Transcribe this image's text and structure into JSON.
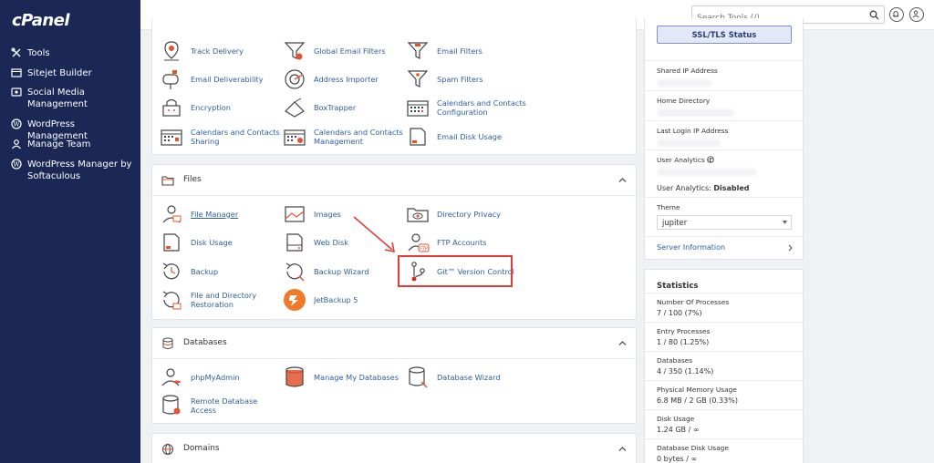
{
  "sidebar": {
    "logo": "cPanel",
    "items": [
      {
        "label": "Tools",
        "icon": "tools-icon"
      },
      {
        "label": "Sitejet Builder",
        "icon": "sitejet-icon"
      },
      {
        "label": "Social Media Management",
        "icon": "social-media-icon"
      },
      {
        "label": "WordPress Management",
        "icon": "wordpress-icon"
      },
      {
        "label": "Manage Team",
        "icon": "team-icon"
      },
      {
        "label": "WordPress Manager by Softaculous",
        "icon": "wordpress-icon"
      }
    ]
  },
  "topbar": {
    "search_placeholder": "Search Tools (/)"
  },
  "email_section": {
    "items": [
      {
        "label": "Track Delivery",
        "icon": "track-delivery-icon"
      },
      {
        "label": "Global Email Filters",
        "icon": "filter-icon"
      },
      {
        "label": "Email Filters",
        "icon": "filter-icon"
      },
      {
        "label": "Email Deliverability",
        "icon": "mailbox-icon"
      },
      {
        "label": "Address Importer",
        "icon": "address-importer-icon"
      },
      {
        "label": "Spam Filters",
        "icon": "spam-filter-icon"
      },
      {
        "label": "Encryption",
        "icon": "encryption-icon"
      },
      {
        "label": "BoxTrapper",
        "icon": "boxtrapper-icon"
      },
      {
        "label": "Calendars and Contacts Configuration",
        "icon": "calendar-icon"
      },
      {
        "label": "Calendars and Contacts Sharing",
        "icon": "calendar-icon"
      },
      {
        "label": "Calendars and Contacts Management",
        "icon": "calendar-icon"
      },
      {
        "label": "Email Disk Usage",
        "icon": "disk-usage-icon"
      }
    ]
  },
  "files_section": {
    "title": "Files",
    "items": [
      {
        "label": "File Manager",
        "icon": "file-manager-icon"
      },
      {
        "label": "Images",
        "icon": "images-icon"
      },
      {
        "label": "Directory Privacy",
        "icon": "directory-privacy-icon"
      },
      {
        "label": "Disk Usage",
        "icon": "disk-usage-icon"
      },
      {
        "label": "Web Disk",
        "icon": "web-disk-icon"
      },
      {
        "label": "FTP Accounts",
        "icon": "ftp-icon"
      },
      {
        "label": "Backup",
        "icon": "backup-icon"
      },
      {
        "label": "Backup Wizard",
        "icon": "backup-wizard-icon"
      },
      {
        "label": "Git™ Version Control",
        "icon": "git-icon"
      },
      {
        "label": "File and Directory Restoration",
        "icon": "restore-icon"
      },
      {
        "label": "JetBackup 5",
        "icon": "jetbackup-icon"
      }
    ]
  },
  "databases_section": {
    "title": "Databases",
    "items": [
      {
        "label": "phpMyAdmin",
        "icon": "phpmyadmin-icon"
      },
      {
        "label": "Manage My Databases",
        "icon": "database-icon"
      },
      {
        "label": "Database Wizard",
        "icon": "database-wizard-icon"
      },
      {
        "label": "Remote Database Access",
        "icon": "remote-db-icon"
      }
    ]
  },
  "domains_section": {
    "title": "Domains"
  },
  "general_info": {
    "ssl_button": "SSL/TLS Status",
    "shared_ip_label": "Shared IP Address",
    "home_dir_label": "Home Directory",
    "last_login_label": "Last Login IP Address",
    "analytics_id_label": "User Analytics ID",
    "analytics_status_label": "User Analytics:",
    "analytics_status_value": "Disabled",
    "theme_label": "Theme",
    "theme_value": "jupiter",
    "server_info_label": "Server Information"
  },
  "statistics": {
    "title": "Statistics",
    "rows": [
      {
        "label": "Number Of Processes",
        "value": "7 / 100  (7%)"
      },
      {
        "label": "Entry Processes",
        "value": "1 / 80  (1.25%)"
      },
      {
        "label": "Databases",
        "value": "4 / 350  (1.14%)"
      },
      {
        "label": "Physical Memory Usage",
        "value": "6.8 MB / 2 GB  (0.33%)"
      },
      {
        "label": "Disk Usage",
        "value": "1.24 GB / ∞"
      },
      {
        "label": "Database Disk Usage",
        "value": "0 bytes / ∞"
      }
    ]
  },
  "colors": {
    "sidebar_bg": "#1b2855",
    "link": "#2c5f9e",
    "highlight": "#e23b3b"
  }
}
